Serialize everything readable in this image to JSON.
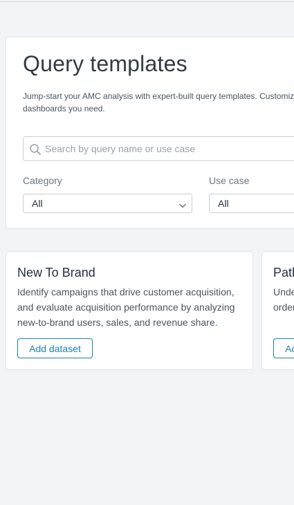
{
  "header": {
    "title": "Query templates",
    "description": "Jump-start your AMC analysis with expert-built query templates. Customize dashboards you need."
  },
  "search": {
    "placeholder": "Search by query name or use case",
    "value": ""
  },
  "filters": {
    "category": {
      "label": "Category",
      "selected": "All"
    },
    "use_case": {
      "label": "Use case",
      "selected": "All"
    }
  },
  "cards": [
    {
      "title": "New To Brand",
      "description": "Identify campaigns that drive customer acquisition, and evaluate acquisition performance by analyzing new-to-brand users, sales, and revenue share.",
      "button_label": "Add dataset"
    },
    {
      "title": "Path to Conversion",
      "description": "Understand the paths to conversion and identify the ordering of ads",
      "button_label": "Add dataset"
    }
  ],
  "colors": {
    "accent": "#1b7fb8",
    "page_background": "#f3f4f6",
    "card_background": "#ffffff"
  },
  "icons": {
    "search": "search-icon",
    "dropdown": "chevron-down-icon"
  }
}
